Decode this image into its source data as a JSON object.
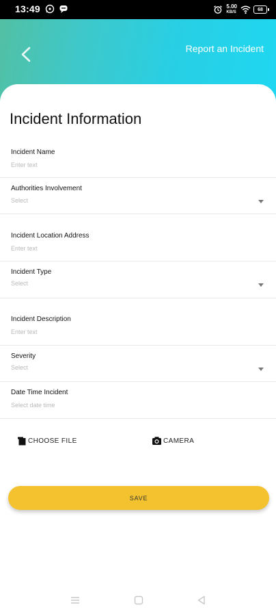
{
  "status_bar": {
    "time": "13:49",
    "left_icons": [
      "whatsapp-icon",
      "chat-bubble-icon"
    ],
    "right_icons": [
      "alarm-icon",
      "speed-indicator-icon",
      "wifi-icon",
      "battery-icon"
    ],
    "speed_value": "5.00",
    "speed_unit": "KB/S",
    "battery": "68"
  },
  "header": {
    "title": "Report an Incident",
    "back_icon": "chevron-left-icon"
  },
  "form": {
    "section_title": "Incident Information",
    "fields": [
      {
        "label": "Incident Name",
        "value": "Enter text",
        "type": "text"
      },
      {
        "label": "Authorities Involvement",
        "value": "Select",
        "type": "select"
      },
      {
        "label": "Incident Location Address",
        "value": "Enter text",
        "type": "text"
      },
      {
        "label": "Incident Type",
        "value": "Select",
        "type": "select"
      },
      {
        "label": "Incident Description",
        "value": "Enter text",
        "type": "text"
      },
      {
        "label": "Severity",
        "value": "Select",
        "type": "select"
      },
      {
        "label": "Date Time Incident",
        "value": "Select date time",
        "type": "datetime"
      }
    ]
  },
  "attachments": {
    "choose_file": "CHOOSE FILE",
    "camera": "CAMERA"
  },
  "actions": {
    "save_label": "SAVE"
  },
  "colors": {
    "header_gradient_start": "#52c0a3",
    "header_gradient_end": "#1fd7f1",
    "save_button": "#f3c22e",
    "placeholder_text": "#b9b9b9"
  },
  "nav_bar": {
    "icons": [
      "menu-icon",
      "home-square-icon",
      "back-triangle-icon"
    ]
  }
}
